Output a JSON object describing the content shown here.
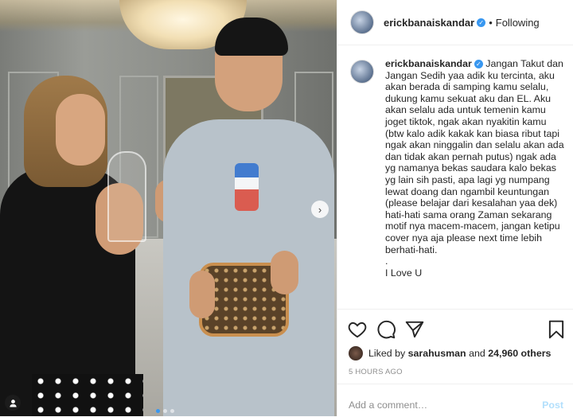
{
  "header": {
    "username": "erickbanaiskandar",
    "separator": "•",
    "follow_status": "Following"
  },
  "caption": {
    "username": "erickbanaiskandar",
    "text": "Jangan Takut dan Jangan Sedih yaa adik ku tercinta, aku akan berada di samping kamu selalu, dukung kamu sekuat aku dan EL. Aku akan selalu ada untuk temenin kamu joget tiktok, ngak akan nyakitin kamu (btw kalo adik kakak kan biasa ribut tapi ngak akan ninggalin dan selalu akan ada dan tidak akan pernah putus) ngak ada yg namanya bekas saudara kalo bekas yg lain sih pasti, apa lagi yg numpang lewat doang dan ngambil keuntungan (please belajar dari kesalahan yaa dek) hati-hati sama orang Zaman sekarang motif nya macem-macem, jangan ketipu cover nya aja please next time lebih berhati-hati.\n.\nI Love U"
  },
  "actions": {
    "like_icon": "heart-icon",
    "comment_icon": "comment-icon",
    "share_icon": "share-icon",
    "save_icon": "bookmark-icon"
  },
  "likes": {
    "prefix": "Liked by",
    "user": "sarahusman",
    "joiner": "and",
    "others": "24,960 others"
  },
  "timestamp": "5 HOURS AGO",
  "comment": {
    "placeholder": "Add a comment…",
    "post_label": "Post"
  },
  "media": {
    "next_icon": "chevron-right-icon",
    "tag_icon": "user-icon",
    "carousel_count": 3,
    "carousel_active": 1
  },
  "colors": {
    "verified": "#3897f0",
    "post_disabled": "#b2dffc",
    "muted": "#8e8e8e"
  }
}
